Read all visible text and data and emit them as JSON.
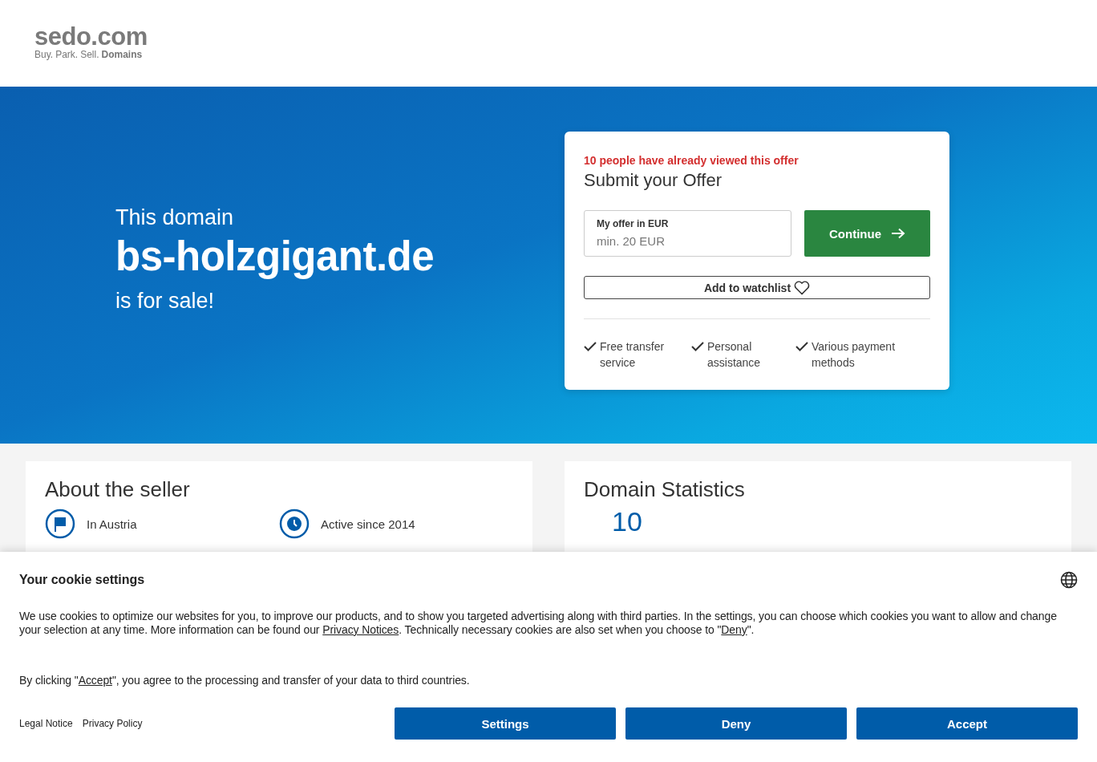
{
  "logo": {
    "name": "sedo.com",
    "tagline": [
      "Buy.",
      "Park.",
      "Sell."
    ],
    "tagline_bold": "Domains"
  },
  "hero": {
    "intro": "This domain",
    "domain": "bs-holzgigant.de",
    "outro": "is for sale!"
  },
  "offer_card": {
    "alert": "10 people have already viewed this offer",
    "title": "Submit your Offer",
    "field_label": "My offer in EUR",
    "placeholder": "min. 20 EUR",
    "continue_button": "Continue",
    "watchlist_button": "Add to watchlist",
    "features": [
      "Free transfer service",
      "Personal assistance",
      "Various payment methods"
    ]
  },
  "seller": {
    "title": "About the seller",
    "items": [
      {
        "kind": "location",
        "text": "In Austria"
      },
      {
        "kind": "time",
        "text": "Active since 2014"
      }
    ]
  },
  "stats": {
    "title": "Domain Statistics",
    "value": "10"
  },
  "cookie_banner": {
    "title": "Your cookie settings",
    "paragraph": [
      {
        "kind": "text",
        "text": "We use cookies to optimize our websites for you, to improve our products, and to show you targeted advertising along with third parties. In the settings, you can choose which cookies you want to allow and change your selection at any time. More information can be found our "
      },
      {
        "kind": "link",
        "text": "Privacy Notices"
      },
      {
        "kind": "text",
        "text": ". Technically necessary cookies are also set when you choose to \""
      },
      {
        "kind": "link",
        "text": "Deny"
      },
      {
        "kind": "text",
        "text": "\"."
      }
    ],
    "consent": [
      {
        "kind": "text",
        "text": "By clicking \""
      },
      {
        "kind": "link",
        "text": "Accept"
      },
      {
        "kind": "text",
        "text": "\", you agree to the processing and transfer of your data to third countries."
      }
    ],
    "links": [
      "Legal Notice",
      "Privacy Policy"
    ],
    "buttons": [
      "Settings",
      "Deny",
      "Accept"
    ]
  }
}
